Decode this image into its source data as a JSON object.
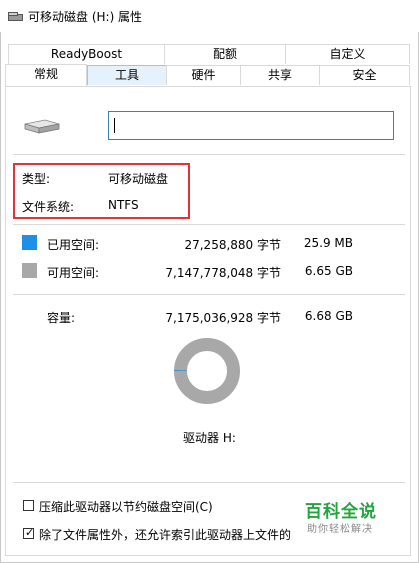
{
  "window": {
    "title": "可移动磁盘 (H:) 属性"
  },
  "tabs": {
    "row1": [
      "ReadyBoost",
      "配额",
      "自定义"
    ],
    "row2": [
      "常规",
      "工具",
      "硬件",
      "共享",
      "安全"
    ]
  },
  "general": {
    "name_value": "",
    "type_label": "类型:",
    "type_value": "可移动磁盘",
    "fs_label": "文件系统:",
    "fs_value": "NTFS",
    "used": {
      "label": "已用空间:",
      "bytes": "27,258,880 字节",
      "size": "25.9 MB",
      "color": "#1e90e6"
    },
    "free": {
      "label": "可用空间:",
      "bytes": "7,147,778,048 字节",
      "size": "6.65 GB",
      "color": "#a8a8a8"
    },
    "capacity": {
      "label": "容量:",
      "bytes": "7,175,036,928 字节",
      "size": "6.68 GB"
    },
    "used_fraction": 0.0038,
    "drive_label": "驱动器 H:",
    "compress_label": "压缩此驱动器以节约磁盘空间(C)",
    "compress_checked": false,
    "index_label": "除了文件属性外，还允许索引此驱动器上文件的",
    "index_checked": true
  },
  "watermark": {
    "title": "百科全说",
    "subtitle": "助你轻松解决"
  }
}
